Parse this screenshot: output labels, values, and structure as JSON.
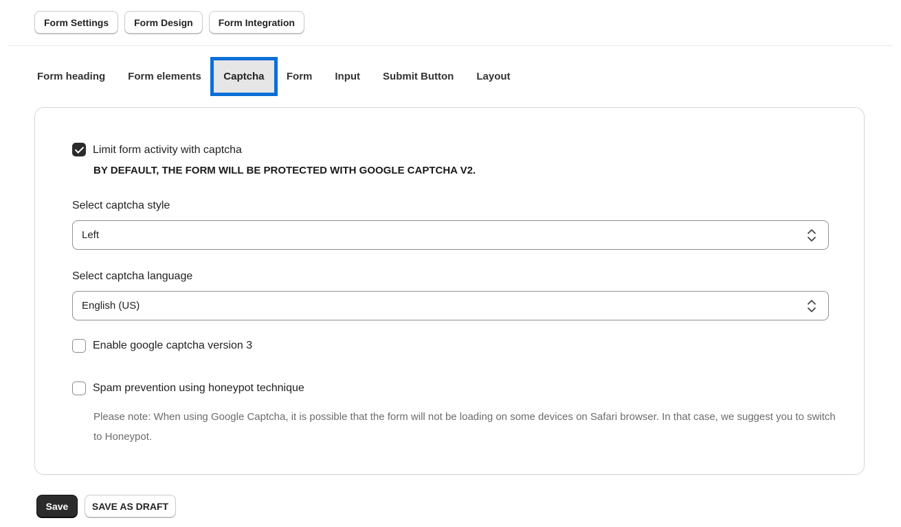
{
  "top_tabs": [
    "Form Settings",
    "Form Design",
    "Form Integration"
  ],
  "sub_tabs": {
    "form_heading": "Form heading",
    "form_elements": "Form elements",
    "captcha": "Captcha",
    "form": "Form",
    "input": "Input",
    "submit_button": "Submit Button",
    "layout": "Layout"
  },
  "active_sub_tab": "Captcha",
  "captcha": {
    "limit_label": "Limit form activity with captcha",
    "limit_checked": true,
    "default_note": "BY DEFAULT, THE FORM WILL BE PROTECTED WITH GOOGLE CAPTCHA V2.",
    "style_label": "Select captcha style",
    "style_value": "Left",
    "language_label": "Select captcha language",
    "language_value": "English (US)",
    "v3_label": "Enable google captcha version 3",
    "v3_checked": false,
    "honeypot_label": "Spam prevention using honeypot technique",
    "honeypot_checked": false,
    "note": "Please note: When using Google Captcha, it is possible that the form will not be loading on some devices on Safari browser. In that case, we suggest you to switch to Honeypot."
  },
  "actions": {
    "save": "Save",
    "save_draft": "SAVE AS DRAFT"
  },
  "colors": {
    "active_tab_border": "#0a6fd6",
    "primary_button": "#2b2b2b"
  },
  "icons": {
    "select_arrows": "chevron-up-down-icon",
    "check": "checkmark-icon"
  }
}
